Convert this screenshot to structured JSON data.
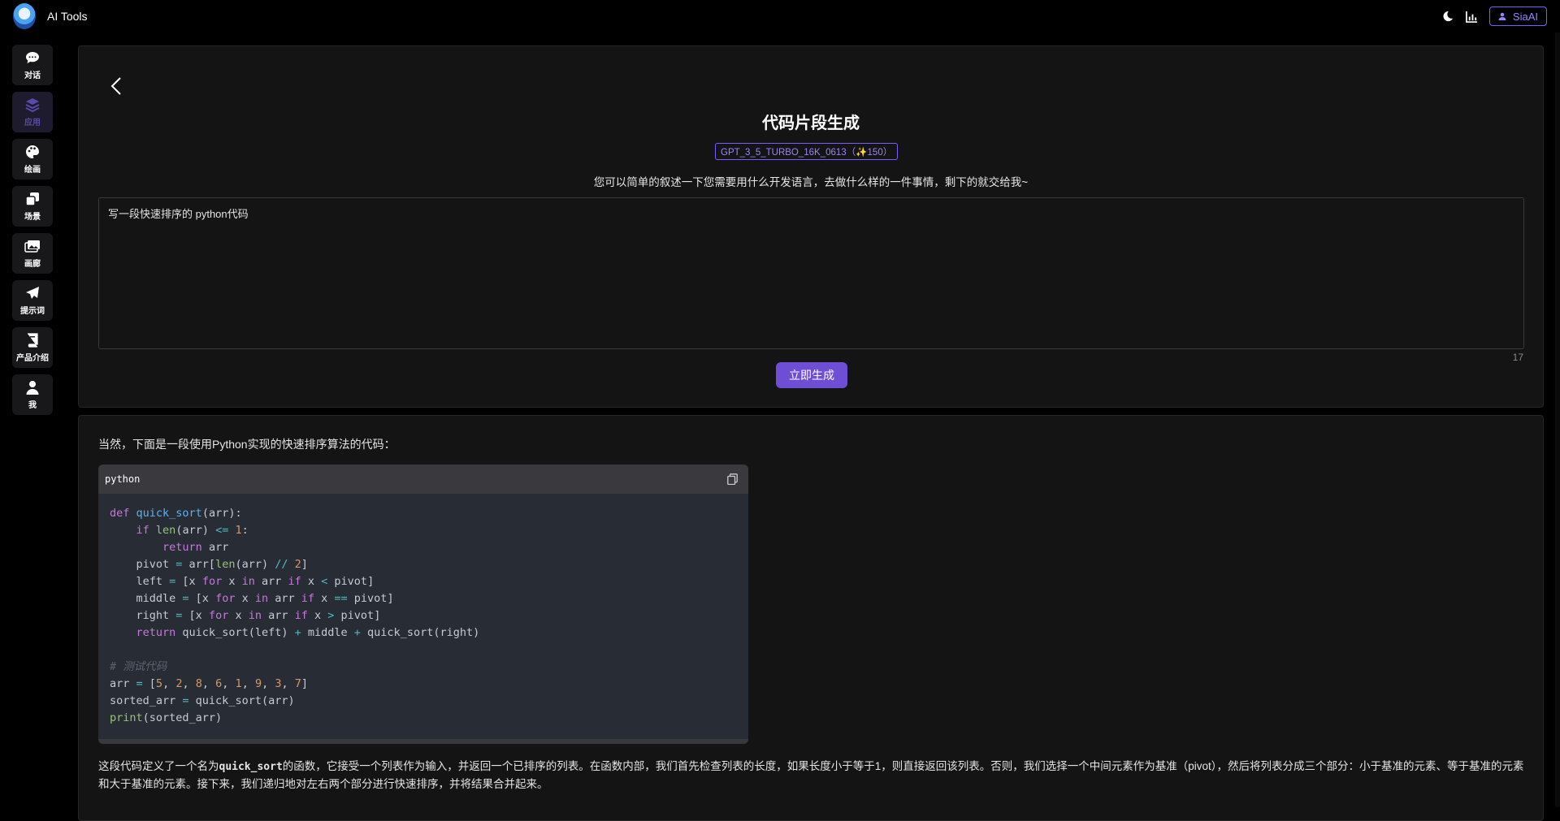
{
  "app": {
    "title": "AI Tools"
  },
  "header": {
    "user_label": "SiaAI"
  },
  "sidebar": {
    "items": [
      {
        "label": "对话",
        "icon": "chat-icon"
      },
      {
        "label": "应用",
        "icon": "layers-icon"
      },
      {
        "label": "绘画",
        "icon": "palette-icon"
      },
      {
        "label": "场景",
        "icon": "clone-icon"
      },
      {
        "label": "画廊",
        "icon": "images-icon"
      },
      {
        "label": "提示词",
        "icon": "send-icon"
      },
      {
        "label": "产品介绍",
        "icon": "book-icon"
      },
      {
        "label": "我",
        "icon": "user-icon"
      }
    ]
  },
  "generator": {
    "title": "代码片段生成",
    "model_badge": "GPT_3_5_TURBO_16K_0613（✨150）",
    "description": "您可以简单的叙述一下您需要用什么开发语言，去做什么样的一件事情，剩下的就交给我~",
    "input_value": "写一段快速排序的 python代码",
    "char_count": "17",
    "submit_label": "立即生成"
  },
  "result": {
    "intro": "当然，下面是一段使用Python实现的快速排序算法的代码：",
    "code_language": "python",
    "explanation_pre": "这段代码定义了一个名为",
    "explanation_code": "quick_sort",
    "explanation_post": "的函数，它接受一个列表作为输入，并返回一个已排序的列表。在函数内部，我们首先检查列表的长度，如果长度小于等于1，则直接返回该列表。否则，我们选择一个中间元素作为基准（pivot），然后将列表分成三个部分：小于基准的元素、等于基准的元素和大于基准的元素。接下来，我们递归地对左右两个部分进行快速排序，并将结果合并起来。"
  },
  "colors": {
    "accent": "#6f4ed6",
    "accent_border": "#7c5cff",
    "background": "#000000",
    "card": "#141414"
  }
}
